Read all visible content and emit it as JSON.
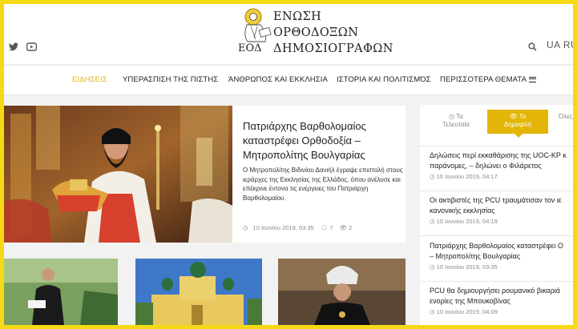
{
  "header": {
    "logo_lines": [
      "ΕΝΩΣΗ",
      "ΟΡΘΟΔΟΞΩΝ",
      "ΔΗΜΟΣΙΟΓΡΑΦΩΝ"
    ],
    "logo_abbr": "ΕΟΔ",
    "lang": "UA RU",
    "social_icons": [
      "twitter-icon",
      "youtube-icon"
    ],
    "search_icon": "search-icon"
  },
  "nav": {
    "items": [
      {
        "label": "ΕΙΔΗΣΕΙΣ",
        "active": true
      },
      {
        "label": "ΥΠΕΡΑΣΠΙΣΗ ΤΗΣ ΠΙΣΤΗΣ"
      },
      {
        "label": "ΆΝΘΡΩΠΟΣ ΚΑΙ ΕΚΚΛΗΣΙΑ"
      },
      {
        "label": "ΙΣΤΟΡΙΑ ΚΑΙ ΠΟΛΙΤΙΣΜΌΣ"
      },
      {
        "label": "ΠΕΡΙΣΣΟΤΕΡΑ ΘΕΜΑΤΑ"
      }
    ]
  },
  "featured": {
    "title": "Πατριάρχης Βαρθολομαίος καταστρέφει Ορθοδοξία – Μητροπολίτης Βουλγαρίας",
    "excerpt": "Ο Μητροπολίτης Βιδινίου Δανιήλ έγραψε επιστολή στους ιεράρχες της Εκκλησίας της Ελλάδος, όπου ανέλυσε και επέκρινε έντονα τις ενέργειες του Πατριάρχη Βαρθολομαίου.",
    "date": "10 Ιουνίου 2019, 03:35",
    "comments": "7",
    "views": "2"
  },
  "sidebar": {
    "tabs": [
      {
        "label1": "Τα",
        "label2": "Τελευταία",
        "icon": "clock-icon"
      },
      {
        "label1": "Τα",
        "label2": "Δημοφιλή",
        "icon": "eye-icon",
        "active": true
      },
      {
        "label1": "Όλες οι",
        "label2": ""
      }
    ],
    "items": [
      {
        "line1": "Δηλώσεις περί εκκαθάρισης της UOC-KP κ",
        "line2": "παράνομες, – δηλώνει ο Φιλάρετος",
        "date": "10 Ιουνίου 2019, 04:17"
      },
      {
        "line1": "Οι ακτιβιστές της PCU τραυμάτισαν τον ιε",
        "line2": "κανονικής εκκλησίας",
        "date": "10 Ιουνίου 2019, 04:19"
      },
      {
        "line1": "Πατριάρχης Βαρθολομαίος καταστρέφει Ο",
        "line2": "– Μητροπολίτης Βουλγαρίας",
        "date": "10 Ιουνίου 2019, 03:35"
      },
      {
        "line1": "PCU θα δημιουργήσει ρουμανικό βικαριά",
        "line2": "ενορίες της Μπουκοβίνας",
        "date": "10 Ιουνίου 2019, 04:09"
      }
    ]
  },
  "colors": {
    "accent": "#e3b507",
    "frame": "#f6d915"
  }
}
